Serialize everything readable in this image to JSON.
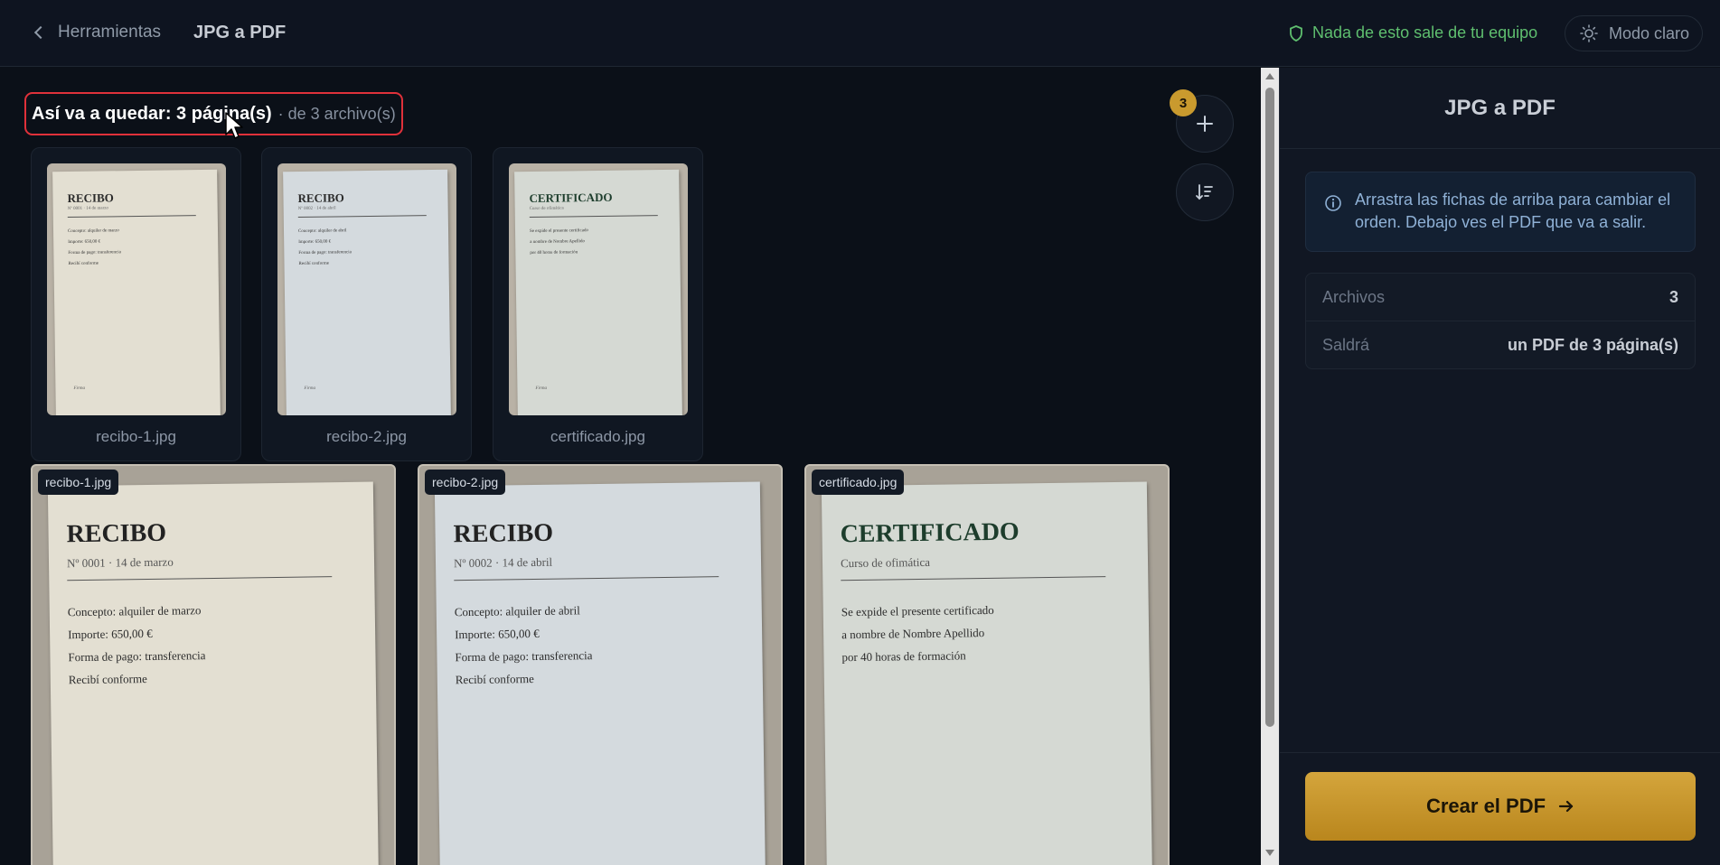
{
  "header": {
    "back_label": "Herramientas",
    "title": "JPG a PDF",
    "privacy_text": "Nada de esto sale de tu equipo",
    "mode_label": "Modo claro"
  },
  "summary": {
    "main": "Así va a quedar: 3 página(s)",
    "sub": "· de 3 archivo(s)"
  },
  "toolbar": {
    "badge_count": "3"
  },
  "files": [
    {
      "name": "recibo-1.jpg",
      "doc_title": "RECIBO",
      "doc_sub": "Nº 0001 · 14 de marzo",
      "lines": [
        "Concepto: alquiler de marzo",
        "Importe: 650,00 €",
        "Forma de pago: transferencia",
        "Recibí conforme"
      ],
      "signature": "Firma"
    },
    {
      "name": "recibo-2.jpg",
      "doc_title": "RECIBO",
      "doc_sub": "Nº 0002 · 14 de abril",
      "lines": [
        "Concepto: alquiler de abril",
        "Importe: 650,00 €",
        "Forma de pago: transferencia",
        "Recibí conforme"
      ],
      "signature": "Firma"
    },
    {
      "name": "certificado.jpg",
      "doc_title": "CERTIFICADO",
      "doc_sub": "Curso de ofimática",
      "lines": [
        "Se expide el presente certificado",
        "a nombre de Nombre Apellido",
        "por 40 horas de formación"
      ],
      "signature": "Firma"
    }
  ],
  "panel": {
    "title": "JPG a PDF",
    "info": "Arrastra las fichas de arriba para cambiar el orden. Debajo ves el PDF que va a salir.",
    "stats": [
      {
        "key": "Archivos",
        "value": "3"
      },
      {
        "key": "Saldrá",
        "value": "un PDF de 3 página(s)"
      }
    ],
    "create_label": "Crear el PDF"
  },
  "colors": {
    "accent": "#c99a2e",
    "privacy": "#5fbf6f",
    "highlight": "#e0313a"
  },
  "icons": [
    "chevron-left-icon",
    "shield-icon",
    "sun-icon",
    "plus-icon",
    "sort-icon",
    "info-icon",
    "arrow-right-icon",
    "mouse-pointer-icon"
  ]
}
